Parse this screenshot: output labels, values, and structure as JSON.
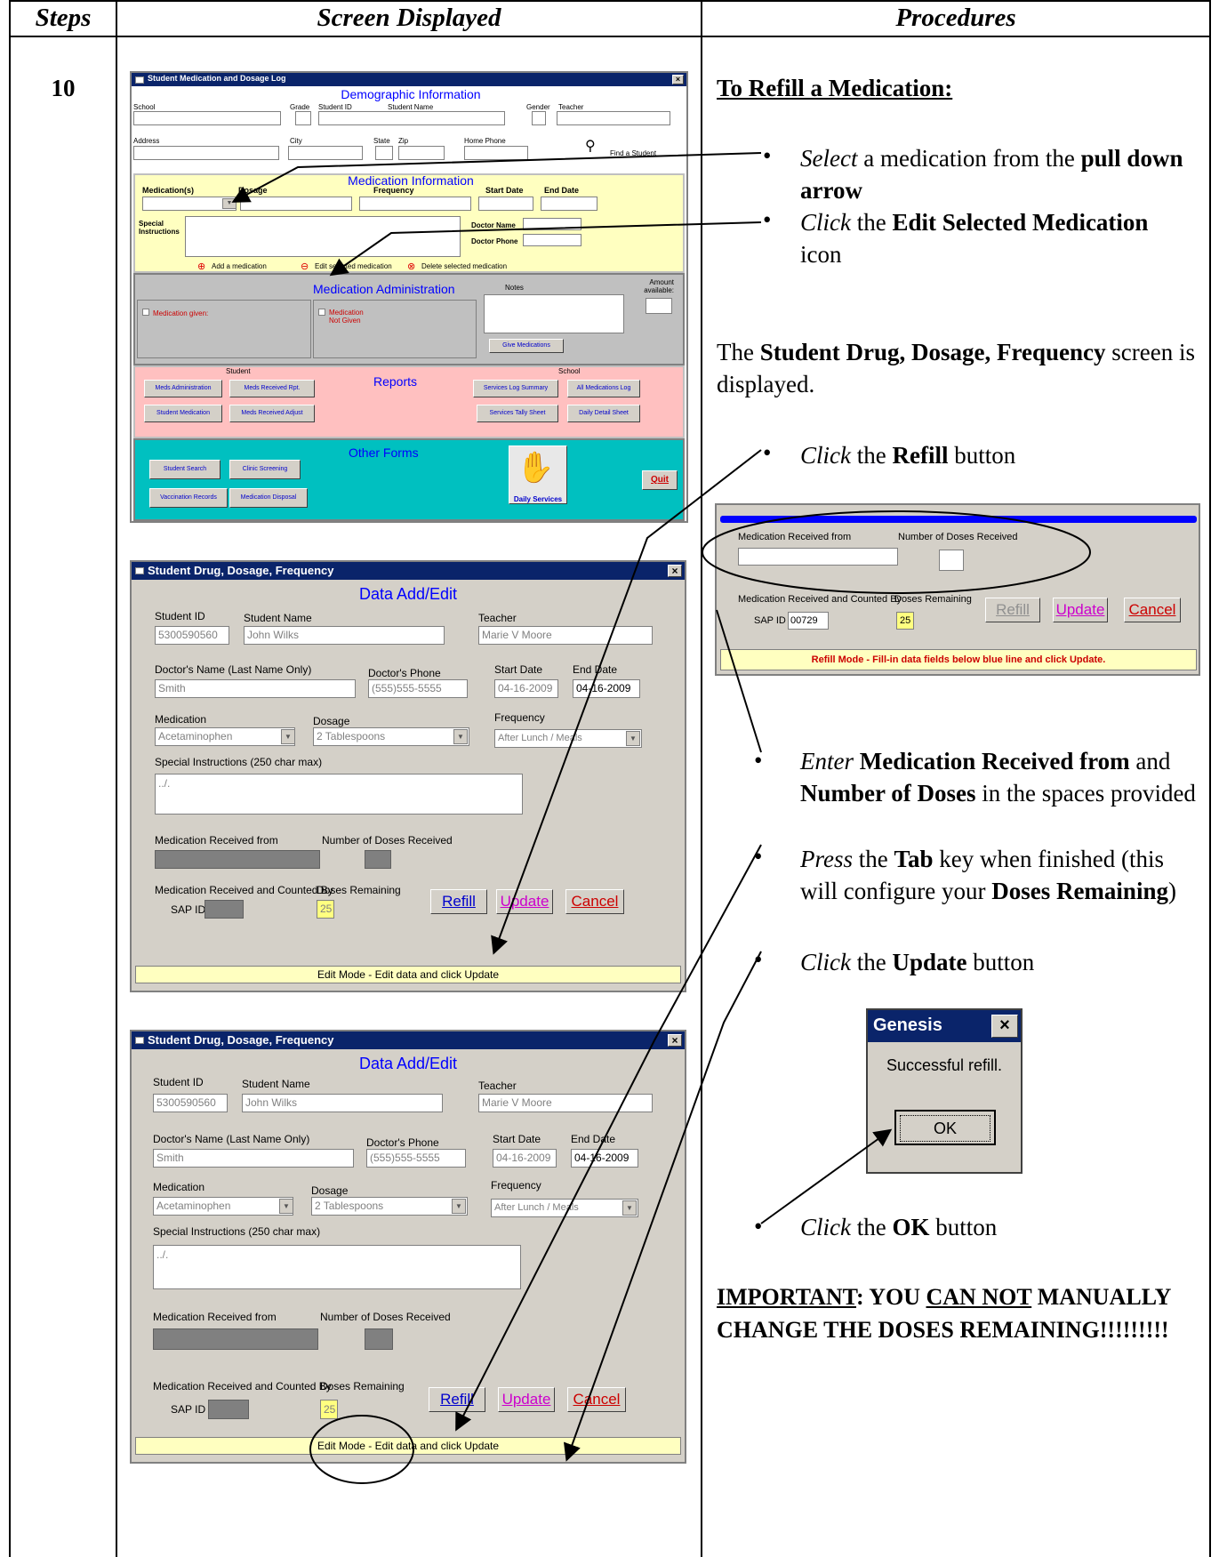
{
  "header": {
    "title_partial": "",
    "col_steps": "Steps",
    "col_screen": "Screen Displayed",
    "col_proc": "Procedures"
  },
  "step_number": "10",
  "screen1": {
    "title": "Student Medication and Dosage Log",
    "close": "×",
    "demo": {
      "heading": "Demographic Information",
      "school": "School",
      "grade": "Grade",
      "student_id": "Student ID",
      "student_name": "Student Name",
      "gender": "Gender",
      "teacher": "Teacher",
      "address": "Address",
      "city": "City",
      "state": "State",
      "zip": "Zip",
      "home_phone": "Home Phone",
      "find": "Find a Student"
    },
    "med": {
      "heading": "Medication Information",
      "medications": "Medication(s)",
      "dosage": "Dosage",
      "frequency": "Frequency",
      "start": "Start Date",
      "end": "End Date",
      "special": "Special Instructions",
      "doc_name": "Doctor Name",
      "doc_phone": "Doctor Phone",
      "add": "Add a medication",
      "edit": "Edit selected medication",
      "delete": "Delete selected medication"
    },
    "admin": {
      "heading": "Medication Administration",
      "given": "Medication given:",
      "not_given": "Medication Not Given",
      "notes": "Notes",
      "amount": "Amount available:",
      "give": "Give Medications"
    },
    "reports": {
      "heading": "Reports",
      "student": "Student",
      "school": "School",
      "b1": "Meds Administration",
      "b2": "Meds Received Rpt.",
      "b3": "Student Medication",
      "b4": "Meds Received Adjust",
      "b5": "Services Log Summary",
      "b6": "All Medications Log",
      "b7": "Services Tally Sheet",
      "b8": "Daily Detail Sheet"
    },
    "other": {
      "heading": "Other Forms",
      "b1": "Student Search",
      "b2": "Clinic Screening",
      "b3": "Vaccination Records",
      "b4": "Medication Disposal",
      "daily": "Daily Services",
      "quit": "Quit"
    }
  },
  "form2": {
    "title": "Student Drug, Dosage, Frequency",
    "close": "×",
    "heading": "Data Add/Edit",
    "student_id_label": "Student ID",
    "student_id": "5300590560",
    "student_name_label": "Student Name",
    "student_name": "John Wilks",
    "teacher_label": "Teacher",
    "teacher": "Marie V Moore",
    "doctor_label": "Doctor's Name (Last Name Only)",
    "doctor": "Smith",
    "phone_label": "Doctor's Phone",
    "phone": "(555)555-5555",
    "start_label": "Start Date",
    "start": "04-16-2009",
    "end_label": "End Date",
    "end": "04-16-2009",
    "medication_label": "Medication",
    "medication": "Acetaminophen",
    "dosage_label": "Dosage",
    "dosage": "2 Tablespoons",
    "frequency_label": "Frequency",
    "frequency": "After Lunch / Meals",
    "special_label": "Special Instructions (250 char max)",
    "special": "../.",
    "received_from_label": "Medication Received from",
    "doses_received_label": "Number of Doses Received",
    "counted_label": "Medication Received and Counted By",
    "sap_label": "SAP ID",
    "remaining_label": "Doses Remaining",
    "remaining": "25",
    "refill": "Refill",
    "update": "Update",
    "cancel": "Cancel",
    "status": "Edit Mode - Edit data and click Update"
  },
  "refill_panel": {
    "received_from_label": "Medication Received from",
    "doses_received_label": "Number of Doses Received",
    "counted_label": "Medication Received and Counted By",
    "remaining_label": "Doses Remaining",
    "sap_label": "SAP ID",
    "sap": "00729",
    "remaining": "25",
    "refill": "Refill",
    "update": "Update",
    "cancel": "Cancel",
    "status": "Refill Mode - Fill-in data fields below blue line and click Update."
  },
  "genesis": {
    "title": "Genesis",
    "close": "×",
    "message": "Successful refill.",
    "ok": "OK"
  },
  "procedures": {
    "heading": "To Refill a Medication:",
    "b1_verb": "Select",
    "b1_a": " a medication from the ",
    "b1_b": "pull down arrow",
    "b2_verb": "Click",
    "b2_a": " the ",
    "b2_b": "Edit Selected Medication",
    "b2_c": " icon",
    "p1_a": "The ",
    "p1_b": "Student Drug, Dosage, Frequency",
    "p1_c": " screen is displayed.",
    "b3_verb": "Click",
    "b3_a": " the ",
    "b3_b": "Refill",
    "b3_c": " button",
    "b4_verb": "Enter",
    "b4_a": " ",
    "b4_b": "Medication Received from",
    "b4_c": " and ",
    "b4_d": "Number of Doses",
    "b4_e": " in the spaces provided",
    "b5_verb": "Press",
    "b5_a": " the ",
    "b5_b": "Tab",
    "b5_c": " key when finished (this will configure your ",
    "b5_d": "Doses Remaining",
    "b5_e": ")",
    "b6_verb": "Click",
    "b6_a": " the ",
    "b6_b": "Update",
    "b6_c": " button",
    "b7_verb": "Click",
    "b7_a": " the ",
    "b7_b": "OK",
    "b7_c": " button",
    "imp_a": "IMPORTANT",
    "imp_b": ":  YOU ",
    "imp_c": "CAN NOT",
    "imp_d": " MANUALLY CHANGE THE DOSES REMAINING!!!!!!!!!"
  }
}
